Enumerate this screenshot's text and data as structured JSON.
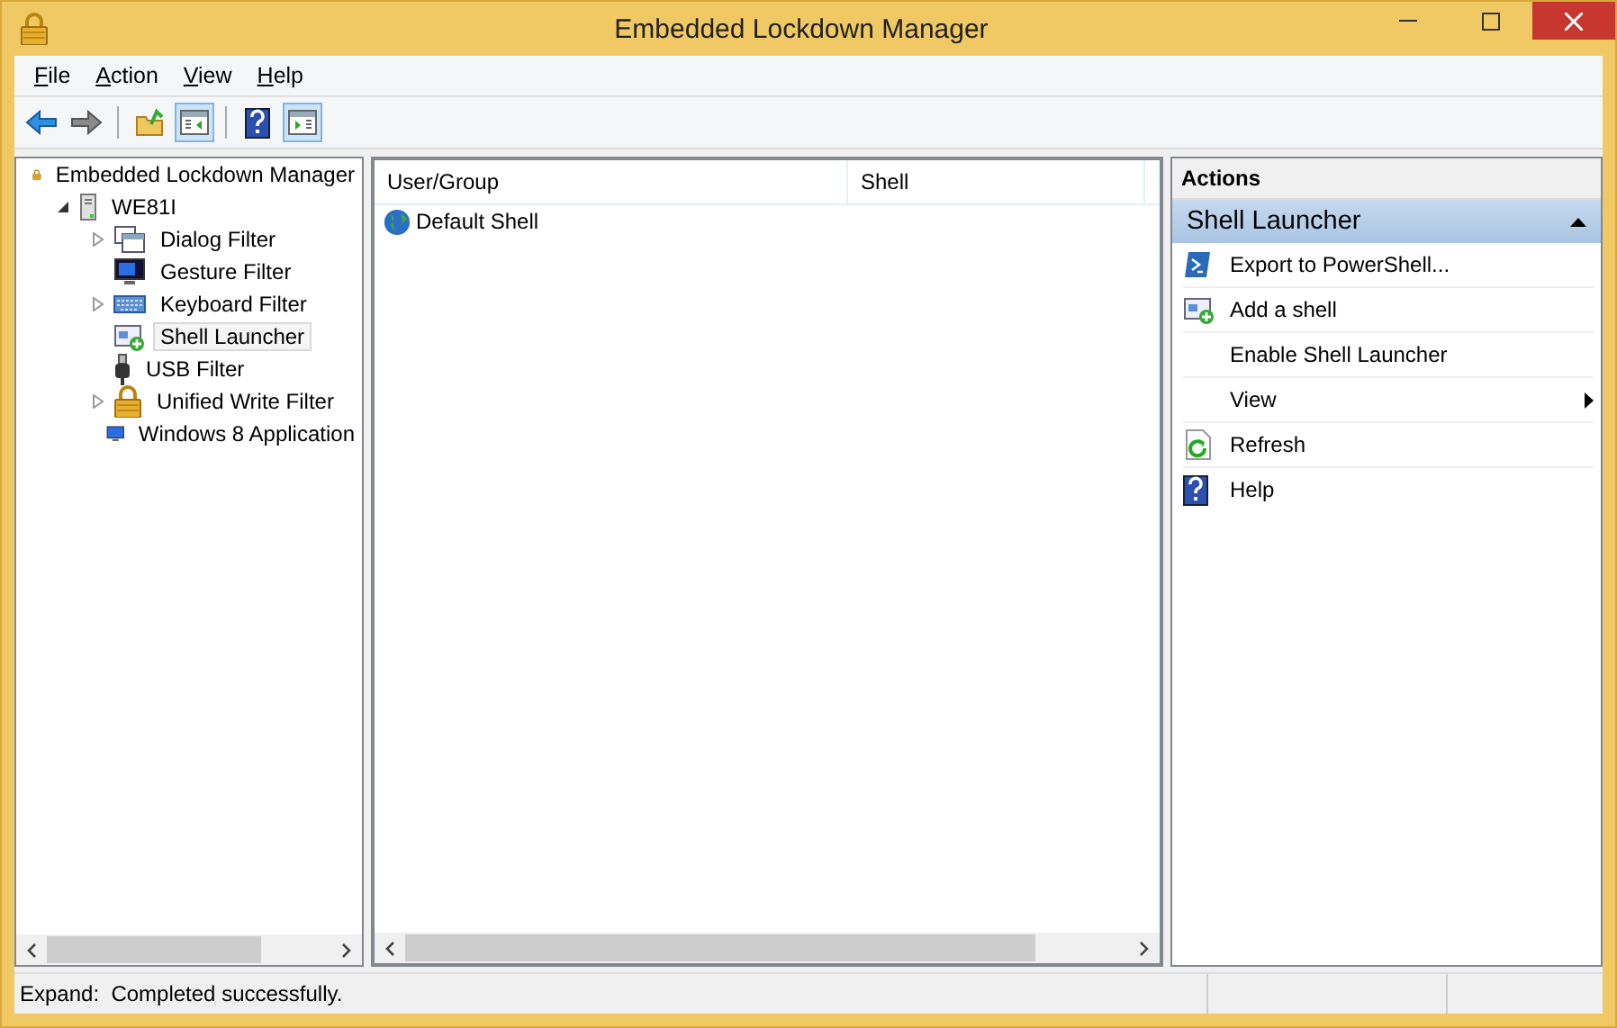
{
  "window": {
    "title": "Embedded Lockdown Manager"
  },
  "menu": [
    {
      "label": "File"
    },
    {
      "label": "Action"
    },
    {
      "label": "View"
    },
    {
      "label": "Help"
    }
  ],
  "toolbar": [
    {
      "kind": "back",
      "disabled": false,
      "on": false
    },
    {
      "kind": "forward",
      "disabled": true,
      "on": false
    },
    {
      "kind": "up",
      "disabled": false,
      "on": false
    },
    {
      "kind": "tree-toggle",
      "disabled": false,
      "on": true
    },
    {
      "kind": "help",
      "disabled": false,
      "on": false
    },
    {
      "kind": "pane-toggle",
      "disabled": false,
      "on": true
    }
  ],
  "tree": [
    {
      "label": "Embedded Lockdown Manager",
      "selected": false,
      "children": [
        {
          "label": "WE81I",
          "expanded": true,
          "selected": false,
          "children": [
            {
              "label": "Dialog Filter",
              "expanded": false,
              "selected": false
            },
            {
              "label": "Gesture Filter",
              "selected": false
            },
            {
              "label": "Keyboard Filter",
              "expanded": false,
              "selected": false
            },
            {
              "label": "Shell Launcher",
              "selected": true
            },
            {
              "label": "USB Filter",
              "selected": false
            },
            {
              "label": "Unified Write Filter",
              "expanded": false,
              "selected": false
            },
            {
              "label": "Windows 8 Application",
              "selected": false
            }
          ]
        }
      ]
    }
  ],
  "table": {
    "columns": [
      "User/Group",
      "Shell"
    ],
    "rows": [
      {
        "cells": [
          "Default Shell",
          ""
        ]
      }
    ]
  },
  "actions": {
    "title": "Actions",
    "section": {
      "label": "Shell Launcher",
      "expanded": true
    },
    "items": [
      {
        "label": "Export to PowerShell...",
        "kind": "command"
      },
      {
        "label": "Add a shell",
        "kind": "command"
      },
      {
        "label": "Enable Shell Launcher",
        "kind": "command"
      },
      {
        "label": "View",
        "kind": "submenu"
      },
      {
        "label": "Refresh",
        "kind": "command"
      },
      {
        "label": "Help",
        "kind": "command"
      }
    ]
  },
  "status_bar": {
    "text": "Expand:  Completed successfully."
  }
}
